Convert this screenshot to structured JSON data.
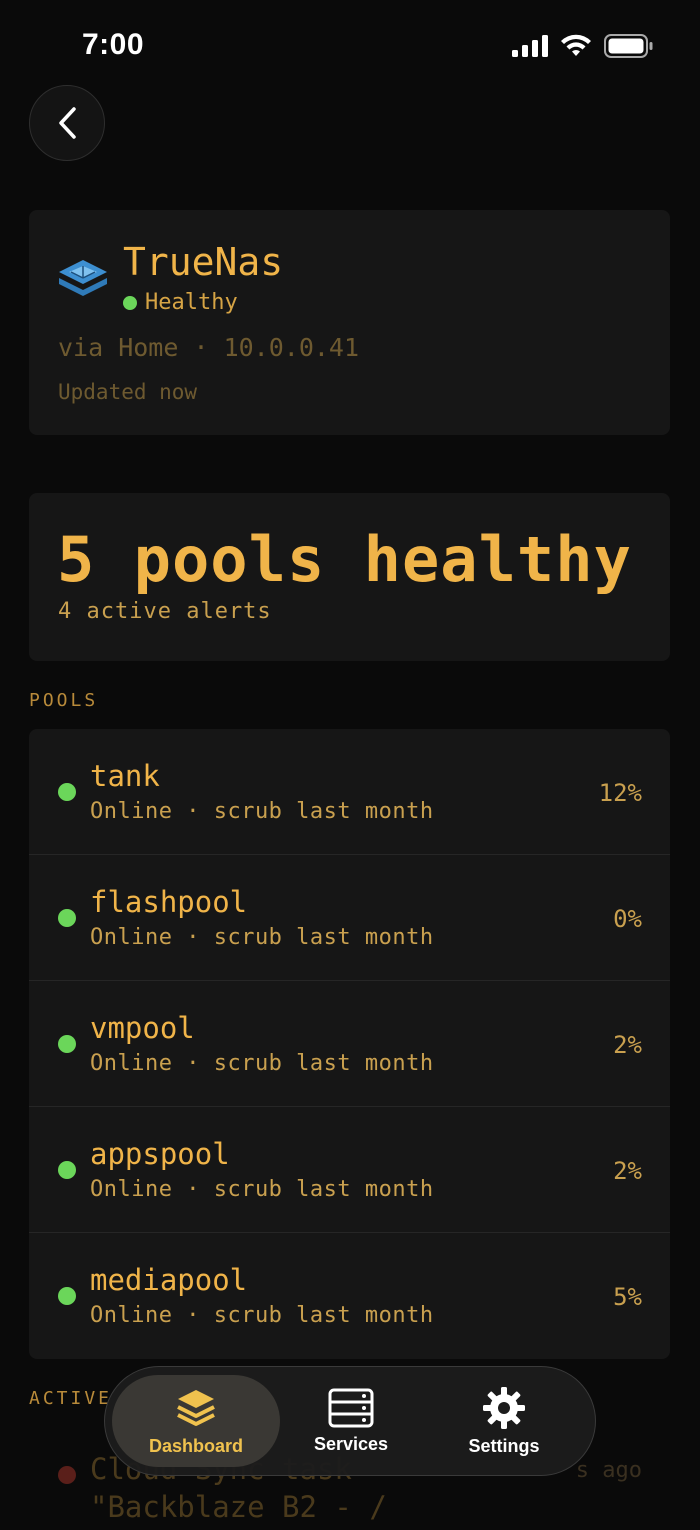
{
  "status_bar": {
    "time": "7:00"
  },
  "header": {
    "title": "TrueNas",
    "status": "Healthy",
    "via": "via Home · 10.0.0.41",
    "updated": "Updated now"
  },
  "summary": {
    "title": "5 pools healthy",
    "subtitle": "4 active alerts"
  },
  "pools_section": {
    "label": "POOLS",
    "items": [
      {
        "name": "tank",
        "detail": "Online · scrub last month",
        "usage": "12%"
      },
      {
        "name": "flashpool",
        "detail": "Online · scrub last month",
        "usage": "0%"
      },
      {
        "name": "vmpool",
        "detail": "Online · scrub last month",
        "usage": "2%"
      },
      {
        "name": "appspool",
        "detail": "Online · scrub last month",
        "usage": "2%"
      },
      {
        "name": "mediapool",
        "detail": "Online · scrub last month",
        "usage": "5%"
      }
    ]
  },
  "alerts_section": {
    "label": "ACTIVE",
    "first_alert_line1": "Cloud Sync task",
    "first_alert_line2": "\"Backblaze B2 - /",
    "first_alert_time": "s ago"
  },
  "tabs": [
    {
      "label": "Dashboard",
      "icon": "layers-icon",
      "active": true
    },
    {
      "label": "Services",
      "icon": "server-icon",
      "active": false
    },
    {
      "label": "Settings",
      "icon": "gear-icon",
      "active": false
    }
  ],
  "colors": {
    "accent": "#f0b449",
    "healthy": "#6bd65a",
    "background": "#0a0a0a",
    "card": "#161616"
  }
}
